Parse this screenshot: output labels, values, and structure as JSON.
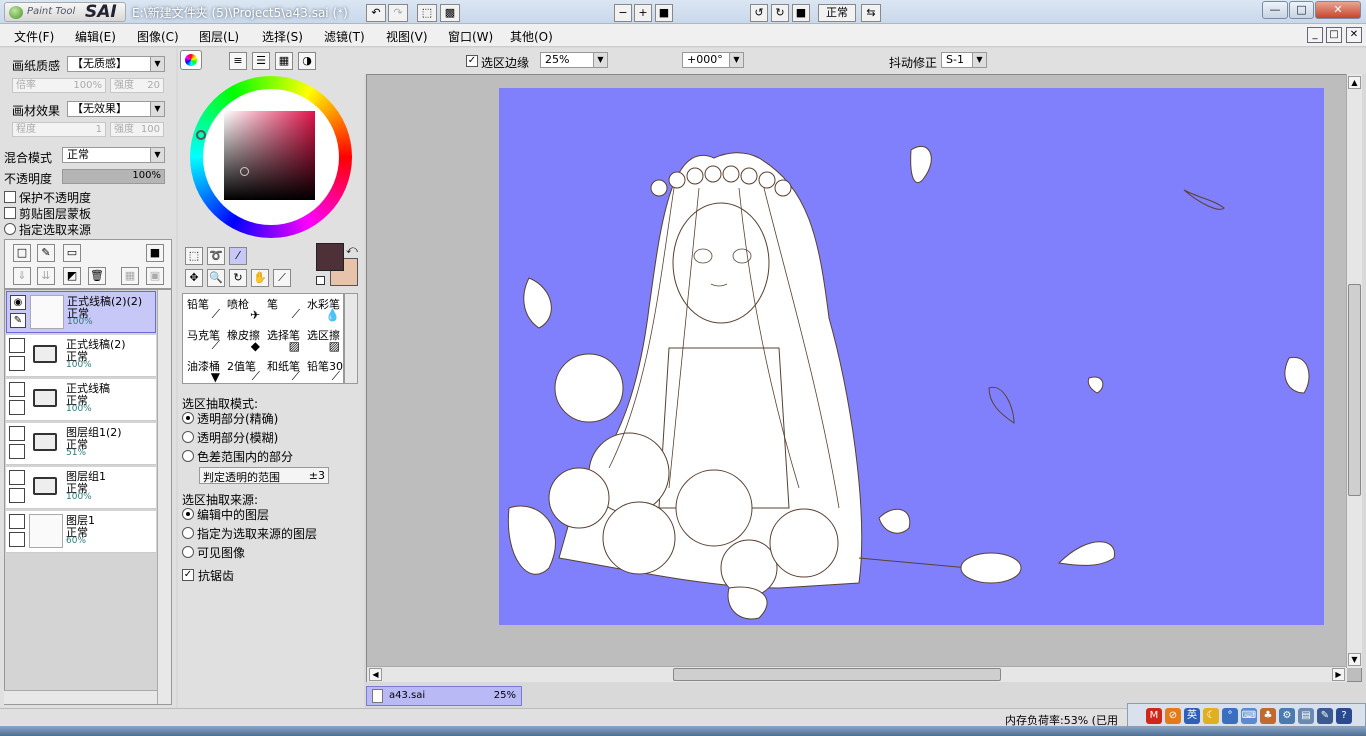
{
  "app": {
    "logo_small": "Paint Tool",
    "logo_big": "SAI",
    "window_title": "E:\\新建文件夹 (5)\\Project5\\a43.sai (*)",
    "window_buttons": [
      "—",
      "□",
      "✕"
    ]
  },
  "menu": {
    "items": [
      "文件(F)",
      "编辑(E)",
      "图像(C)",
      "图层(L)",
      "选择(S)",
      "滤镜(T)",
      "视图(V)",
      "窗口(W)",
      "其他(O)"
    ],
    "mdi_buttons": [
      "_",
      "□",
      "✕"
    ]
  },
  "left": {
    "paper_quality_label": "画纸质感",
    "paper_quality_value": "【无质感】",
    "rate_label": "倍率",
    "rate_value": "100%",
    "strength_label": "强度",
    "strength_value": "20",
    "paper_effect_label": "画材效果",
    "paper_effect_value": "【无效果】",
    "degree_label": "程度",
    "degree_value": "1",
    "strength2_label": "强度",
    "strength2_value": "100",
    "blend_label": "混合模式",
    "blend_value": "正常",
    "opacity_label": "不透明度",
    "opacity_value": "100%",
    "opacity_fraction": 1.0,
    "protect_opacity": "保护不透明度",
    "clip_mask": "剪贴图层蒙板",
    "selection_source": "指定选取来源"
  },
  "layers": [
    {
      "name": "正式线稿(2)(2)",
      "mode": "正常",
      "opacity": "100%",
      "selected": true,
      "folder": false
    },
    {
      "name": "正式线稿(2)",
      "mode": "正常",
      "opacity": "100%",
      "selected": false,
      "folder": true
    },
    {
      "name": "正式线稿",
      "mode": "正常",
      "opacity": "100%",
      "selected": false,
      "folder": true
    },
    {
      "name": "图层组1(2)",
      "mode": "正常",
      "opacity": "51%",
      "selected": false,
      "folder": true
    },
    {
      "name": "图层组1",
      "mode": "正常",
      "opacity": "100%",
      "selected": false,
      "folder": true
    },
    {
      "name": "图层1",
      "mode": "正常",
      "opacity": "60%",
      "selected": false,
      "folder": false
    }
  ],
  "colors": {
    "primary": "#4d3038",
    "secondary": "#e8c3ab",
    "canvas_bg": "#8080fc",
    "selected_layer": "#c8c8f8"
  },
  "brushes": [
    {
      "name": "铅笔",
      "icon": "pencil-icon"
    },
    {
      "name": "喷枪",
      "icon": "airbrush-icon"
    },
    {
      "name": "笔",
      "icon": "pen-icon"
    },
    {
      "name": "水彩笔",
      "icon": "watercolor-icon"
    },
    {
      "name": "马克笔",
      "icon": "marker-icon"
    },
    {
      "name": "橡皮擦",
      "icon": "eraser-icon"
    },
    {
      "name": "选择笔",
      "icon": "select-pen-icon"
    },
    {
      "name": "选区擦",
      "icon": "select-eraser-icon"
    },
    {
      "name": "油漆桶",
      "icon": "bucket-icon"
    },
    {
      "name": "2值笔",
      "icon": "binary-pen-icon"
    },
    {
      "name": "和纸笔",
      "icon": "washi-pen-icon"
    },
    {
      "name": "铅笔30",
      "icon": "pencil30-icon"
    }
  ],
  "selection": {
    "mode_title": "选区抽取模式:",
    "modes": [
      "透明部分(精确)",
      "透明部分(模糊)",
      "色差范围内的部分"
    ],
    "mode_selected": 0,
    "range_label": "判定透明的范围",
    "range_value": "±3",
    "source_title": "选区抽取来源:",
    "sources": [
      "编辑中的图层",
      "指定为选取来源的图层",
      "可见图像"
    ],
    "source_selected": 0,
    "antialias": "抗锯齿"
  },
  "toolbar": {
    "select_edge": "选区边缘",
    "zoom": "25%",
    "angle": "+000°",
    "mode": "正常",
    "stabilizer_label": "抖动修正",
    "stabilizer_value": "S-1"
  },
  "file_tab": {
    "name": "a43.sai",
    "zoom": "25%"
  },
  "status": {
    "memory": "内存负荷率:53% (已用"
  },
  "ime": {
    "lang": "英"
  }
}
